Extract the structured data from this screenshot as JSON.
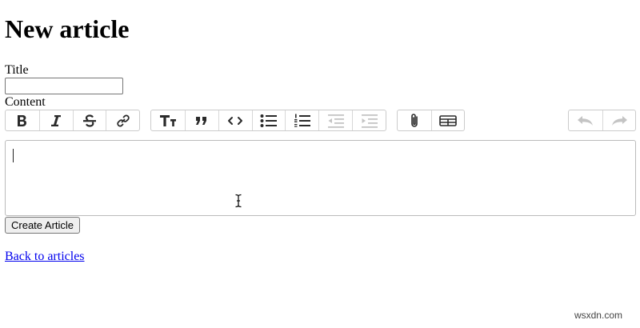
{
  "page": {
    "heading": "New article"
  },
  "form": {
    "title_label": "Title",
    "title_value": "",
    "content_label": "Content",
    "submit_label": "Create Article"
  },
  "toolbar": {
    "text_tools": [
      {
        "name": "bold-button",
        "icon": "bold-icon",
        "enabled": true
      },
      {
        "name": "italic-button",
        "icon": "italic-icon",
        "enabled": true
      },
      {
        "name": "strikethrough-button",
        "icon": "strikethrough-icon",
        "enabled": true
      },
      {
        "name": "link-button",
        "icon": "link-icon",
        "enabled": true
      }
    ],
    "block_tools": [
      {
        "name": "heading-button",
        "icon": "heading-icon",
        "enabled": true
      },
      {
        "name": "quote-button",
        "icon": "quote-icon",
        "enabled": true
      },
      {
        "name": "code-button",
        "icon": "code-icon",
        "enabled": true
      },
      {
        "name": "bullet-list-button",
        "icon": "bullet-list-icon",
        "enabled": true
      },
      {
        "name": "numbered-list-button",
        "icon": "numbered-list-icon",
        "enabled": true
      },
      {
        "name": "decrease-indent-button",
        "icon": "outdent-icon",
        "enabled": false
      },
      {
        "name": "increase-indent-button",
        "icon": "indent-icon",
        "enabled": false
      }
    ],
    "file_tools": [
      {
        "name": "attach-file-button",
        "icon": "paperclip-icon",
        "enabled": true
      },
      {
        "name": "insert-table-button",
        "icon": "table-icon",
        "enabled": true
      }
    ],
    "history_tools": [
      {
        "name": "undo-button",
        "icon": "undo-icon",
        "enabled": false
      },
      {
        "name": "redo-button",
        "icon": "redo-icon",
        "enabled": false
      }
    ]
  },
  "links": {
    "back": "Back to articles"
  },
  "watermark": "wsxdn.com",
  "colors": {
    "link": "#0000ee",
    "icon_active": "#2a2a2a",
    "icon_disabled": "#c4c4c4"
  }
}
